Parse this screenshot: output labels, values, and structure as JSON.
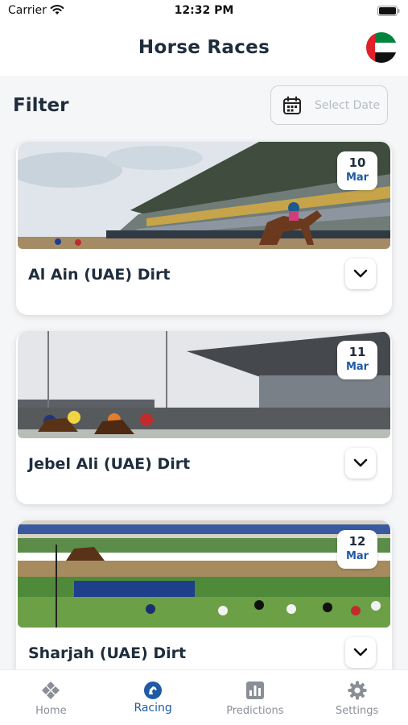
{
  "status_bar": {
    "carrier": "Carrier",
    "time": "12:32 PM"
  },
  "header": {
    "title": "Horse Races"
  },
  "filter": {
    "label": "Filter",
    "date_placeholder": "Select Date"
  },
  "races": [
    {
      "name": "Al Ain (UAE) Dirt",
      "day": "10",
      "month": "Mar"
    },
    {
      "name": "Jebel Ali (UAE) Dirt",
      "day": "11",
      "month": "Mar"
    },
    {
      "name": "Sharjah (UAE) Dirt",
      "day": "12",
      "month": "Mar"
    }
  ],
  "tabs": [
    {
      "label": "Home",
      "icon": "home-icon"
    },
    {
      "label": "Racing",
      "icon": "racing-icon",
      "active": true
    },
    {
      "label": "Predictions",
      "icon": "predictions-icon"
    },
    {
      "label": "Settings",
      "icon": "settings-icon"
    }
  ],
  "colors": {
    "accent": "#1f5aa6",
    "title": "#1f2d3d",
    "inactive_tab": "#8a8f96"
  }
}
